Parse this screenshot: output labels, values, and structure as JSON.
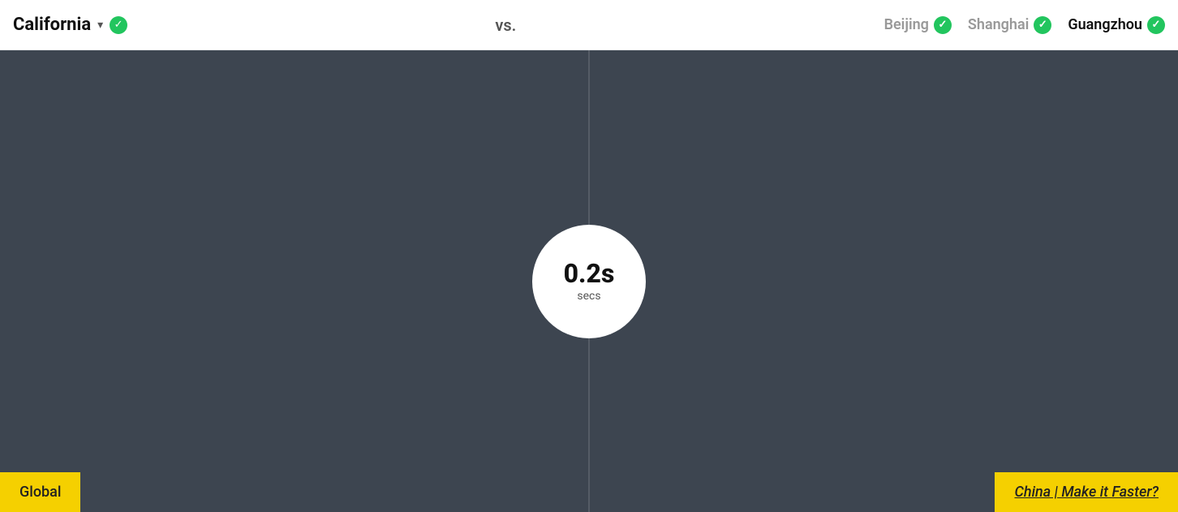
{
  "header": {
    "title": "California",
    "chevron": "▾",
    "vs_label": "vs.",
    "locations": [
      {
        "name": "Beijing",
        "active": false
      },
      {
        "name": "Shanghai",
        "active": false
      },
      {
        "name": "Guangzhou",
        "active": true
      }
    ]
  },
  "main": {
    "time_value": "0.2s",
    "time_unit": "secs"
  },
  "bottom": {
    "left_label": "Global",
    "right_label_static": "China | Make it ",
    "right_label_link": "Faster",
    "right_label_suffix": "?"
  }
}
